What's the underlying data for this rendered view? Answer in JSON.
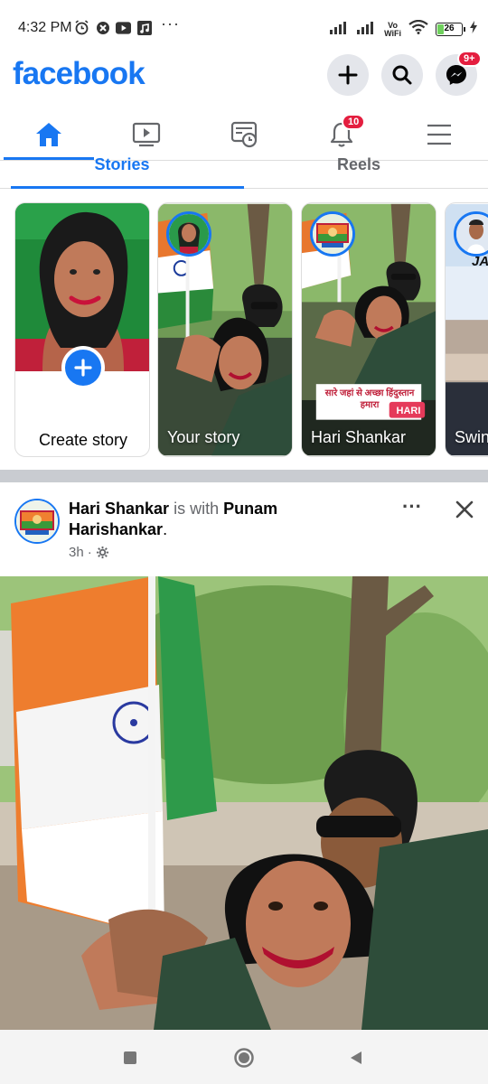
{
  "status_bar": {
    "time": "4:32 PM",
    "dots": "···",
    "vowifi_line1": "Vo",
    "vowifi_line2": "WiFi",
    "battery": "26",
    "battery_level": 0.26
  },
  "header": {
    "logo": "facebook",
    "messenger_badge": "9+"
  },
  "nav": {
    "notifications_badge": "10"
  },
  "subtabs": {
    "stories": "Stories",
    "reels": "Reels"
  },
  "stories": {
    "create_label": "Create story",
    "items": [
      {
        "label": "Your story",
        "overlay_hindi": "",
        "tag": ""
      },
      {
        "label": "Hari Shankar",
        "overlay_hindi": "सारे जहां से अच्छा हिंदुस्तान हमारा",
        "tag": "HARI"
      },
      {
        "label": "Swin",
        "overlay_hindi": "",
        "tag": ""
      }
    ],
    "partial_card_text": "JA"
  },
  "post": {
    "author": "Hari Shankar",
    "with_text": "is with",
    "tagged": "Punam Harishankar",
    "period": ".",
    "time": "3h",
    "dot": "·",
    "more": "···"
  },
  "colors": {
    "brand": "#1877f2",
    "badge": "#e41e3f",
    "muted": "#65676b"
  }
}
